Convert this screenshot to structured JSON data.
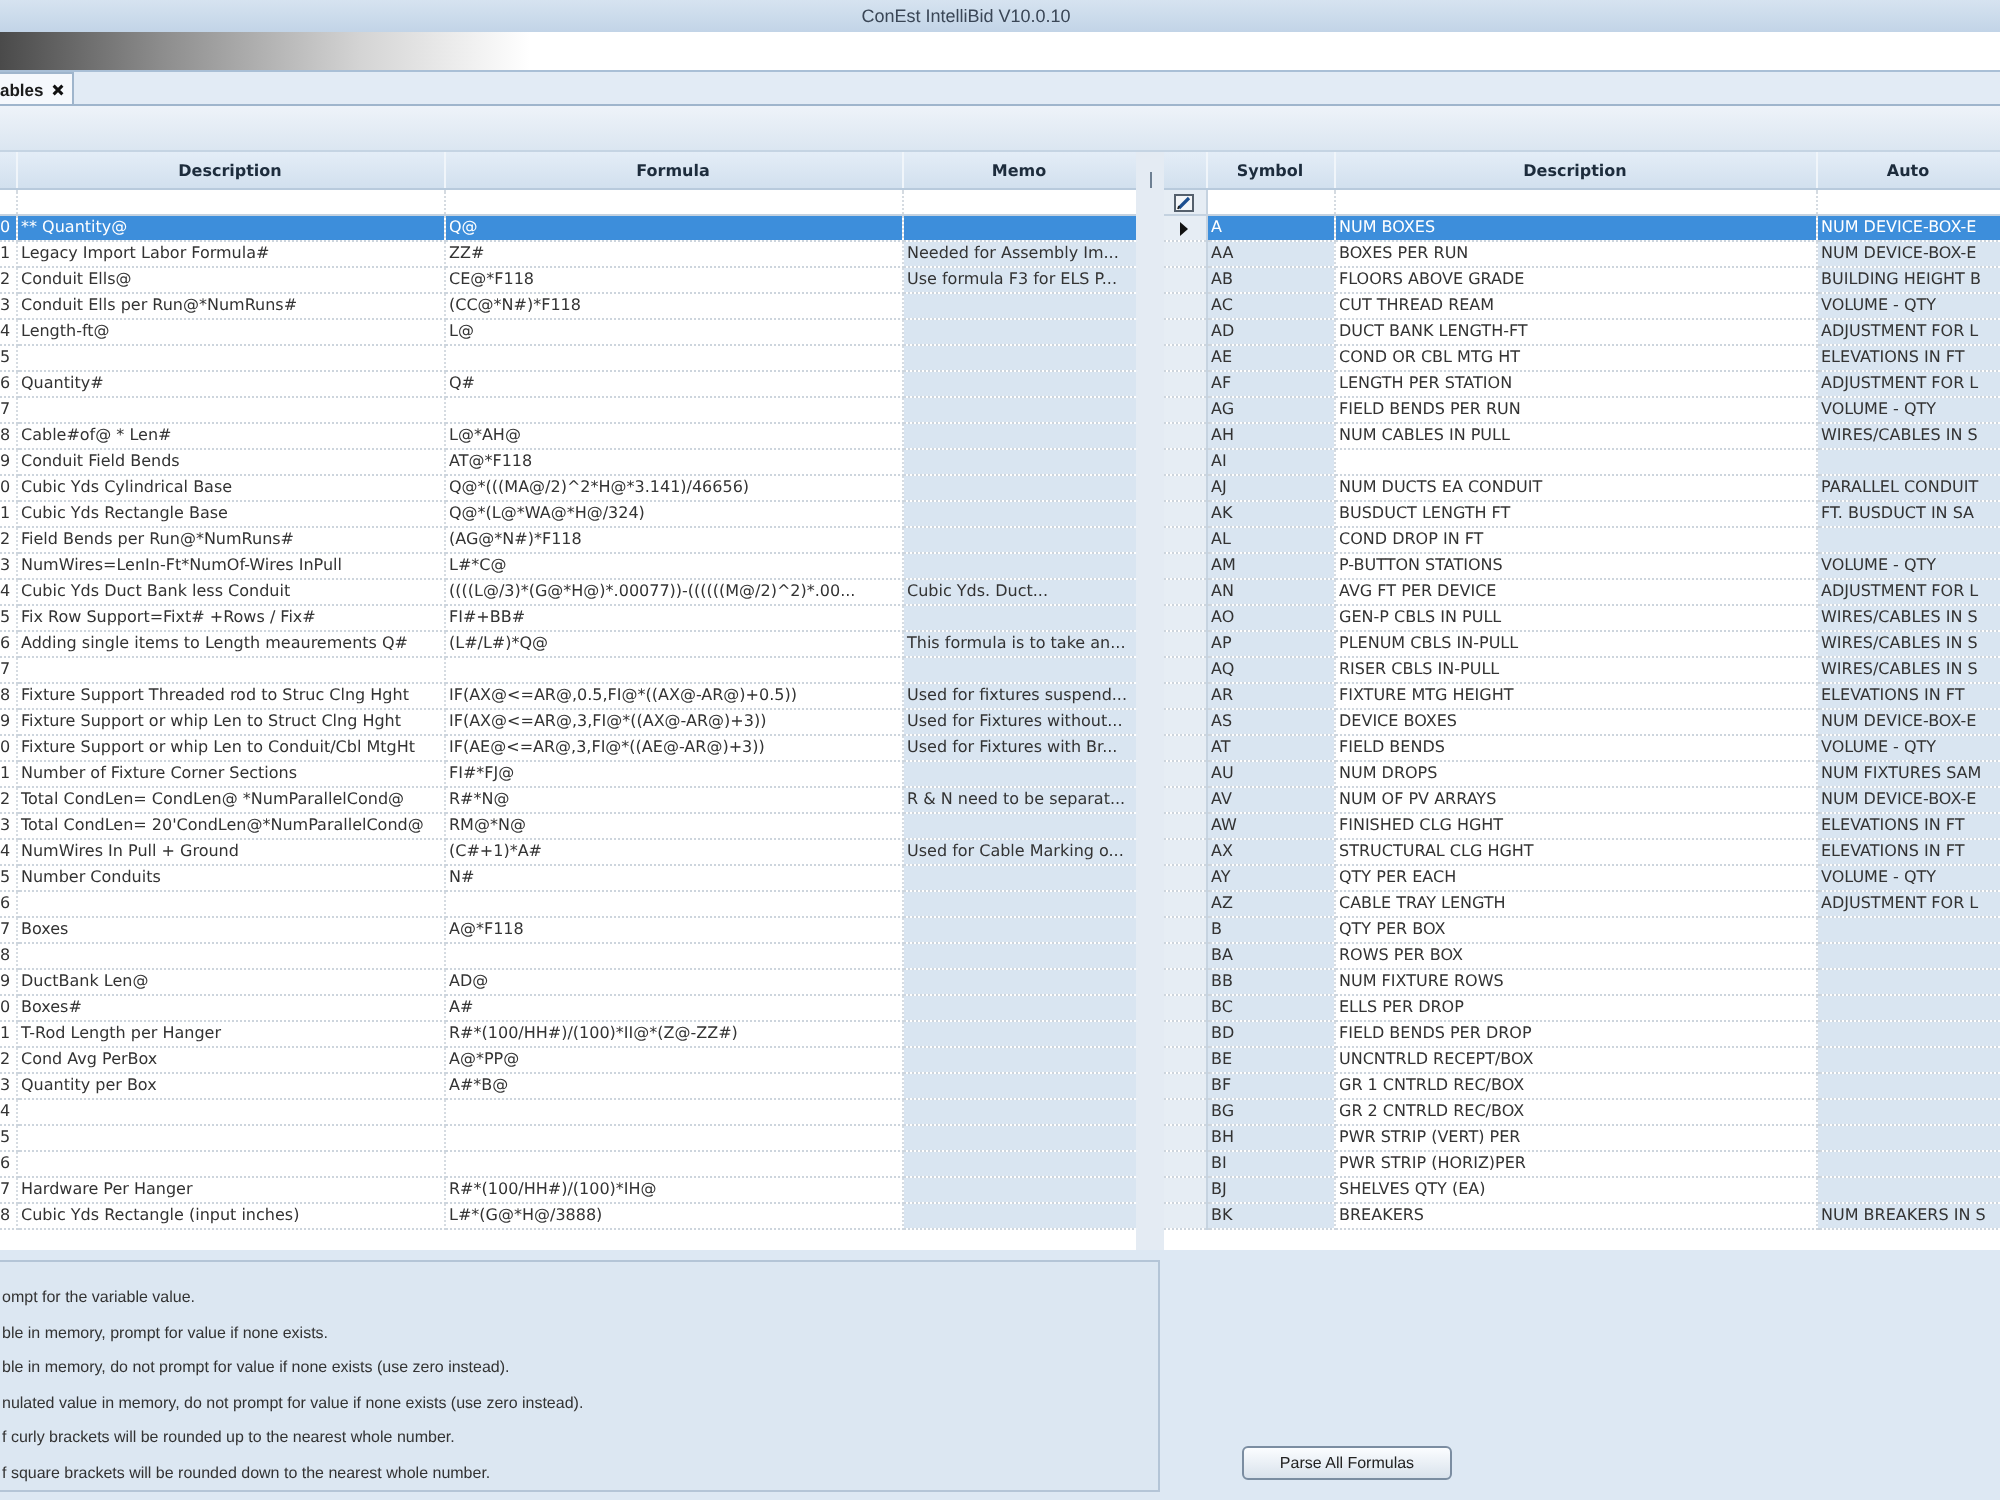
{
  "window": {
    "title": "ConEst IntelliBid V10.0.10"
  },
  "tabs": [
    {
      "label": "ables",
      "selected": true
    }
  ],
  "formulas_table": {
    "columns": [
      "Description",
      "Formula",
      "Memo"
    ],
    "rows": [
      {
        "number": "0",
        "description": "** Quantity@",
        "formula": "Q@",
        "selected": true
      },
      {
        "number": "1",
        "description": "Legacy Import Labor Formula#",
        "formula": "ZZ#",
        "memo": "Needed for Assembly Im...",
        "selected": false
      },
      {
        "number": "2",
        "description": "Conduit Ells@",
        "formula": "CE@*F118",
        "memo": "Use formula F3 for ELS P...",
        "selected": false
      },
      {
        "number": "3",
        "description": "Conduit Ells per Run@*NumRuns#",
        "formula": "(CC@*N#)*F118",
        "selected": false
      },
      {
        "number": "4",
        "description": "Length-ft@",
        "formula": "L@",
        "selected": false
      },
      {
        "number": "5",
        "selected": false
      },
      {
        "number": "6",
        "description": "Quantity#",
        "formula": "Q#",
        "selected": false
      },
      {
        "number": "7",
        "selected": false
      },
      {
        "number": "8",
        "description": "Cable#of@ * Len#",
        "formula": "L@*AH@",
        "selected": false
      },
      {
        "number": "9",
        "description": "Conduit Field Bends",
        "formula": "AT@*F118",
        "selected": false
      },
      {
        "number": "0",
        "description": "Cubic Yds Cylindrical Base",
        "formula": "Q@*(((MA@/2)^2*H@*3.141)/46656)",
        "selected": false
      },
      {
        "number": "1",
        "description": "Cubic Yds Rectangle Base",
        "formula": "Q@*(L@*WA@*H@/324)",
        "selected": false
      },
      {
        "number": "2",
        "description": "Field Bends per Run@*NumRuns#",
        "formula": "(AG@*N#)*F118",
        "selected": false
      },
      {
        "number": "3",
        "description": "NumWires=LenIn-Ft*NumOf-Wires InPull",
        "formula": "L#*C@",
        "selected": false
      },
      {
        "number": "4",
        "description": "Cubic Yds Duct Bank less Conduit",
        "formula": "((((L@/3)*(G@*H@)*.00077))-((((((M@/2)^2)*.00...",
        "memo": "Cubic Yds. Duct...",
        "selected": false
      },
      {
        "number": "5",
        "description": "Fix Row Support=Fixt# +Rows / Fix#",
        "formula": "FI#+BB#",
        "selected": false
      },
      {
        "number": "6",
        "description": "Adding single items to Length meaurements Q#",
        "formula": "(L#/L#)*Q@",
        "memo": "This formula is to take an...",
        "selected": false
      },
      {
        "number": "7",
        "selected": false
      },
      {
        "number": "8",
        "description": "Fixture Support Threaded rod to Struc Clng Hght",
        "formula": "IF(AX@<=AR@,0.5,FI@*((AX@-AR@)+0.5))",
        "memo": "Used for fixtures suspend...",
        "selected": false
      },
      {
        "number": "9",
        "description": "Fixture Support or whip Len to Struct Clng Hght",
        "formula": "IF(AX@<=AR@,3,FI@*((AX@-AR@)+3))",
        "memo": "Used for Fixtures without...",
        "selected": false
      },
      {
        "number": "0",
        "description": "Fixture Support or whip Len to Conduit/Cbl MtgHt",
        "formula": "IF(AE@<=AR@,3,FI@*((AE@-AR@)+3))",
        "memo": "Used for Fixtures with Br...",
        "selected": false
      },
      {
        "number": "1",
        "description": "Number of Fixture Corner Sections",
        "formula": "FI#*FJ@",
        "selected": false
      },
      {
        "number": "2",
        "description": "Total CondLen= CondLen@ *NumParallelCond@",
        "formula": "R#*N@",
        "memo": "R & N need to be separat...",
        "selected": false
      },
      {
        "number": "3",
        "description": "Total CondLen= 20'CondLen@*NumParallelCond@",
        "formula": "RM@*N@",
        "selected": false
      },
      {
        "number": "4",
        "description": "NumWires In Pull + Ground",
        "formula": "(C#+1)*A#",
        "memo": "Used for Cable Marking o...",
        "selected": false
      },
      {
        "number": "5",
        "description": "Number Conduits",
        "formula": "N#",
        "selected": false
      },
      {
        "number": "6",
        "selected": false
      },
      {
        "number": "7",
        "description": "Boxes",
        "formula": "A@*F118",
        "selected": false
      },
      {
        "number": "8",
        "selected": false
      },
      {
        "number": "9",
        "description": "DuctBank Len@",
        "formula": "AD@",
        "selected": false
      },
      {
        "number": "0",
        "description": "Boxes#",
        "formula": "A#",
        "selected": false
      },
      {
        "number": "1",
        "description": "T-Rod Length per Hanger",
        "formula": "R#*(100/HH#)/(100)*II@*(Z@-ZZ#)",
        "selected": false
      },
      {
        "number": "2",
        "description": "Cond Avg PerBox",
        "formula": "A@*PP@",
        "selected": false
      },
      {
        "number": "3",
        "description": "Quantity per Box",
        "formula": "A#*B@",
        "selected": false
      },
      {
        "number": "4",
        "selected": false
      },
      {
        "number": "5",
        "selected": false
      },
      {
        "number": "6",
        "selected": false
      },
      {
        "number": "7",
        "description": "Hardware Per Hanger",
        "formula": "R#*(100/HH#)/(100)*IH@",
        "selected": false
      },
      {
        "number": "8",
        "description": "Cubic Yds Rectangle (input inches)",
        "formula": "L#*(G@*H@/3888)",
        "selected": false
      }
    ]
  },
  "symbols_table": {
    "columns": [
      "Symbol",
      "Description",
      "Auto"
    ],
    "rows": [
      {
        "symbol": "A",
        "description": "NUM BOXES",
        "auto": "NUM DEVICE-BOX-E",
        "selected": true
      },
      {
        "symbol": "AA",
        "description": "BOXES PER RUN",
        "auto": "NUM DEVICE-BOX-E",
        "selected": false
      },
      {
        "symbol": "AB",
        "description": "FLOORS ABOVE GRADE",
        "auto": "BUILDING HEIGHT B",
        "selected": false
      },
      {
        "symbol": "AC",
        "description": "CUT THREAD REAM",
        "auto": "VOLUME - QTY",
        "selected": false
      },
      {
        "symbol": "AD",
        "description": "DUCT BANK LENGTH-FT",
        "auto": "ADJUSTMENT FOR L",
        "selected": false
      },
      {
        "symbol": "AE",
        "description": "COND OR CBL MTG HT",
        "auto": "ELEVATIONS IN FT",
        "selected": false
      },
      {
        "symbol": "AF",
        "description": "LENGTH PER STATION",
        "auto": "ADJUSTMENT FOR L",
        "selected": false
      },
      {
        "symbol": "AG",
        "description": "FIELD BENDS PER RUN",
        "auto": "VOLUME - QTY",
        "selected": false
      },
      {
        "symbol": "AH",
        "description": "NUM CABLES IN PULL",
        "auto": "WIRES/CABLES IN S",
        "selected": false
      },
      {
        "symbol": "AI",
        "selected": false
      },
      {
        "symbol": "AJ",
        "description": "NUM DUCTS EA CONDUIT",
        "auto": "PARALLEL CONDUIT",
        "selected": false
      },
      {
        "symbol": "AK",
        "description": "BUSDUCT LENGTH FT",
        "auto": "FT. BUSDUCT IN SA",
        "selected": false
      },
      {
        "symbol": "AL",
        "description": "COND DROP IN FT",
        "selected": false
      },
      {
        "symbol": "AM",
        "description": "P-BUTTON STATIONS",
        "auto": "VOLUME - QTY",
        "selected": false
      },
      {
        "symbol": "AN",
        "description": "AVG FT PER DEVICE",
        "auto": "ADJUSTMENT FOR L",
        "selected": false
      },
      {
        "symbol": "AO",
        "description": "GEN-P CBLS IN PULL",
        "auto": "WIRES/CABLES IN S",
        "selected": false
      },
      {
        "symbol": "AP",
        "description": "PLENUM CBLS IN-PULL",
        "auto": "WIRES/CABLES IN S",
        "selected": false
      },
      {
        "symbol": "AQ",
        "description": "RISER CBLS IN-PULL",
        "auto": "WIRES/CABLES IN S",
        "selected": false
      },
      {
        "symbol": "AR",
        "description": "FIXTURE MTG HEIGHT",
        "auto": "ELEVATIONS IN FT",
        "selected": false
      },
      {
        "symbol": "AS",
        "description": "DEVICE BOXES",
        "auto": "NUM DEVICE-BOX-E",
        "selected": false
      },
      {
        "symbol": "AT",
        "description": "FIELD BENDS",
        "auto": "VOLUME - QTY",
        "selected": false
      },
      {
        "symbol": "AU",
        "description": "NUM DROPS",
        "auto": "NUM FIXTURES SAM",
        "selected": false
      },
      {
        "symbol": "AV",
        "description": "NUM OF PV ARRAYS",
        "auto": "NUM DEVICE-BOX-E",
        "selected": false
      },
      {
        "symbol": "AW",
        "description": "FINISHED CLG HGHT",
        "auto": "ELEVATIONS IN FT",
        "selected": false
      },
      {
        "symbol": "AX",
        "description": "STRUCTURAL CLG HGHT",
        "auto": "ELEVATIONS IN FT",
        "selected": false
      },
      {
        "symbol": "AY",
        "description": "QTY PER EACH",
        "auto": "VOLUME - QTY",
        "selected": false
      },
      {
        "symbol": "AZ",
        "description": "CABLE TRAY LENGTH",
        "auto": "ADJUSTMENT FOR L",
        "selected": false
      },
      {
        "symbol": "B",
        "description": "QTY PER BOX",
        "selected": false
      },
      {
        "symbol": "BA",
        "description": "ROWS PER BOX",
        "selected": false
      },
      {
        "symbol": "BB",
        "description": "NUM FIXTURE ROWS",
        "selected": false
      },
      {
        "symbol": "BC",
        "description": "ELLS PER DROP",
        "selected": false
      },
      {
        "symbol": "BD",
        "description": "FIELD BENDS PER DROP",
        "selected": false
      },
      {
        "symbol": "BE",
        "description": "UNCNTRLD RECEPT/BOX",
        "selected": false
      },
      {
        "symbol": "BF",
        "description": "GR 1 CNTRLD REC/BOX",
        "selected": false
      },
      {
        "symbol": "BG",
        "description": "GR 2 CNTRLD REC/BOX",
        "selected": false
      },
      {
        "symbol": "BH",
        "description": "PWR STRIP (VERT) PER",
        "selected": false
      },
      {
        "symbol": "BI",
        "description": "PWR STRIP (HORIZ)PER",
        "selected": false
      },
      {
        "symbol": "BJ",
        "description": "SHELVES QTY (EA)",
        "selected": false
      },
      {
        "symbol": "BK",
        "description": "BREAKERS",
        "auto": "NUM BREAKERS IN S",
        "selected": false
      }
    ]
  },
  "notes": [
    "ompt for the variable value.",
    "ble in memory, prompt for value if none exists.",
    "ble in memory, do not prompt for value if none exists (use zero instead).",
    "nulated value in memory, do not prompt for value if none exists (use zero instead).",
    "f curly brackets will be rounded up to the nearest whole number.",
    "f square brackets will be rounded down to the nearest whole number."
  ],
  "parse_button": {
    "label": "Parse All Formulas"
  }
}
